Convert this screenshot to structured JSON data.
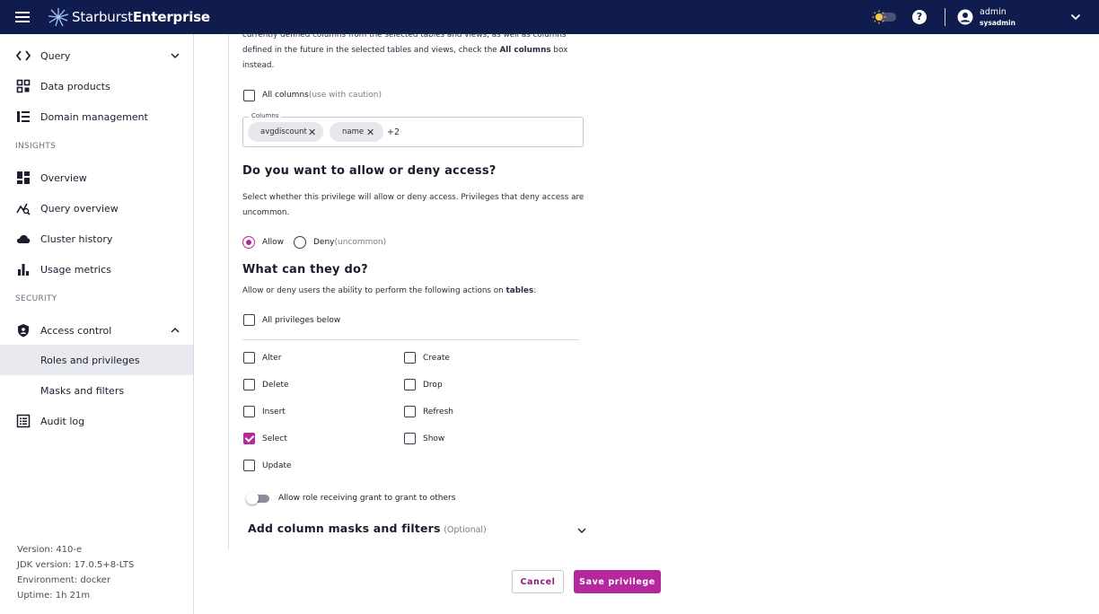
{
  "header": {
    "brand_light": "Starburst",
    "brand_bold": "Enterprise",
    "help_glyph": "?",
    "user_name": "admin",
    "user_role": "sysadmin",
    "colors": {
      "bar": "#0f1c4d",
      "accent": "#b5279d"
    }
  },
  "sidebar": {
    "items": [
      {
        "label": "Query",
        "icon": "code-brackets-icon"
      },
      {
        "label": "Data products",
        "icon": "grid-icon"
      },
      {
        "label": "Domain management",
        "icon": "list-icon"
      },
      {
        "label": "Overview",
        "icon": "dashboard-icon"
      },
      {
        "label": "Query overview",
        "icon": "query-insights-icon"
      },
      {
        "label": "Cluster history",
        "icon": "cloud-icon"
      },
      {
        "label": "Usage metrics",
        "icon": "bar-chart-icon"
      },
      {
        "label": "Access control",
        "icon": "shield-icon"
      },
      {
        "label": "Roles and privileges"
      },
      {
        "label": "Masks and filters"
      },
      {
        "label": "Audit log",
        "icon": "audit-log-icon"
      }
    ],
    "sections": {
      "insights": "INSIGHTS",
      "security": "SECURITY"
    },
    "active_item": "Roles and privileges",
    "version": {
      "version": "Version: 410-e",
      "jdk": "JDK version: 17.0.5+8-LTS",
      "environment": "Environment: docker",
      "uptime": "Uptime: 1h 21m"
    }
  },
  "form": {
    "intro_line1": "currently defined columns from the selected tables and views, as well as columns",
    "intro_line2_pre": "defined in the future in the selected tables and views, check the ",
    "intro_line2_bold": "All columns",
    "intro_line2_post": " box",
    "intro_line3": "instead.",
    "all_columns_label": "All columns",
    "all_columns_note": "(use with caution)",
    "all_columns_checked": false,
    "columns_legend": "Columns",
    "columns_chips": [
      "avgdiscount",
      "name"
    ],
    "columns_more": "+2",
    "access_heading": "Do you want to allow or deny access?",
    "access_desc_line1": "Select whether this privilege will allow or deny access. Privileges that deny access are",
    "access_desc_line2": "uncommon.",
    "allow_label": "Allow",
    "deny_label": "Deny",
    "deny_note": "(uncommon)",
    "access_selected": "Allow",
    "actions_heading": "What can they do?",
    "actions_desc_pre": "Allow or deny users the ability to perform the following actions on ",
    "actions_desc_bold": "tables",
    "actions_desc_post": ":",
    "all_privileges_label": "All privileges below",
    "privileges": [
      {
        "label": "Alter",
        "checked": false
      },
      {
        "label": "Create",
        "checked": false
      },
      {
        "label": "Delete",
        "checked": false
      },
      {
        "label": "Drop",
        "checked": false
      },
      {
        "label": "Insert",
        "checked": false
      },
      {
        "label": "Refresh",
        "checked": false
      },
      {
        "label": "Select",
        "checked": true
      },
      {
        "label": "Show",
        "checked": false
      },
      {
        "label": "Update",
        "checked": false
      }
    ],
    "grant_toggle_label": "Allow role receiving grant to grant to others",
    "grant_toggle_on": false,
    "masks_heading": "Add column masks and filters",
    "masks_note": "(Optional)",
    "cancel_label": "Cancel",
    "save_label": "Save privilege"
  }
}
